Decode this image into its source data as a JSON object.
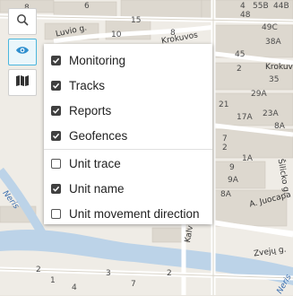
{
  "toolbar": {
    "search_icon": "search-icon",
    "visibility_icon": "eye-icon",
    "layers_icon": "map-icon"
  },
  "visibility_menu": {
    "group_layers": [
      {
        "label": "Monitoring",
        "checked": true
      },
      {
        "label": "Tracks",
        "checked": true
      },
      {
        "label": "Reports",
        "checked": true
      },
      {
        "label": "Geofences",
        "checked": true
      }
    ],
    "group_units": [
      {
        "label": "Unit trace",
        "checked": false
      },
      {
        "label": "Unit name",
        "checked": true
      },
      {
        "label": "Unit movement direction",
        "checked": false
      }
    ]
  },
  "map": {
    "labels": {
      "l1": "8",
      "l2": "6",
      "l3": "15",
      "l4": "4",
      "l5": "55B",
      "l6": "44B",
      "l7": "48",
      "l8": "8",
      "l9": "Luvio g.",
      "l10": "10",
      "l11": "Krokuvos",
      "l12": "49C",
      "l13": "38A",
      "l14": "45",
      "l15": "Krokuvos",
      "l16": "2",
      "l17": "35",
      "l18": "29A",
      "l19": "21",
      "l20": "17A",
      "l21": "23A",
      "l22": "8A",
      "l23": "7",
      "l24": "2",
      "l25": "1A",
      "l26": "9",
      "l27": "9A",
      "l28": "8A",
      "l29": "A. Juocapa",
      "l30": "Zvejų g.",
      "l31": "Kalv",
      "l32": "Neris",
      "l33": "Neris",
      "l34": "2",
      "l35": "1",
      "l36": "3",
      "l37": "7",
      "l38": "Šilicko g.",
      "l39": "2",
      "l40": "4"
    }
  },
  "colors": {
    "accent": "#4bb6dd",
    "checkbox": "#404040",
    "river": "#bcd3e8"
  }
}
